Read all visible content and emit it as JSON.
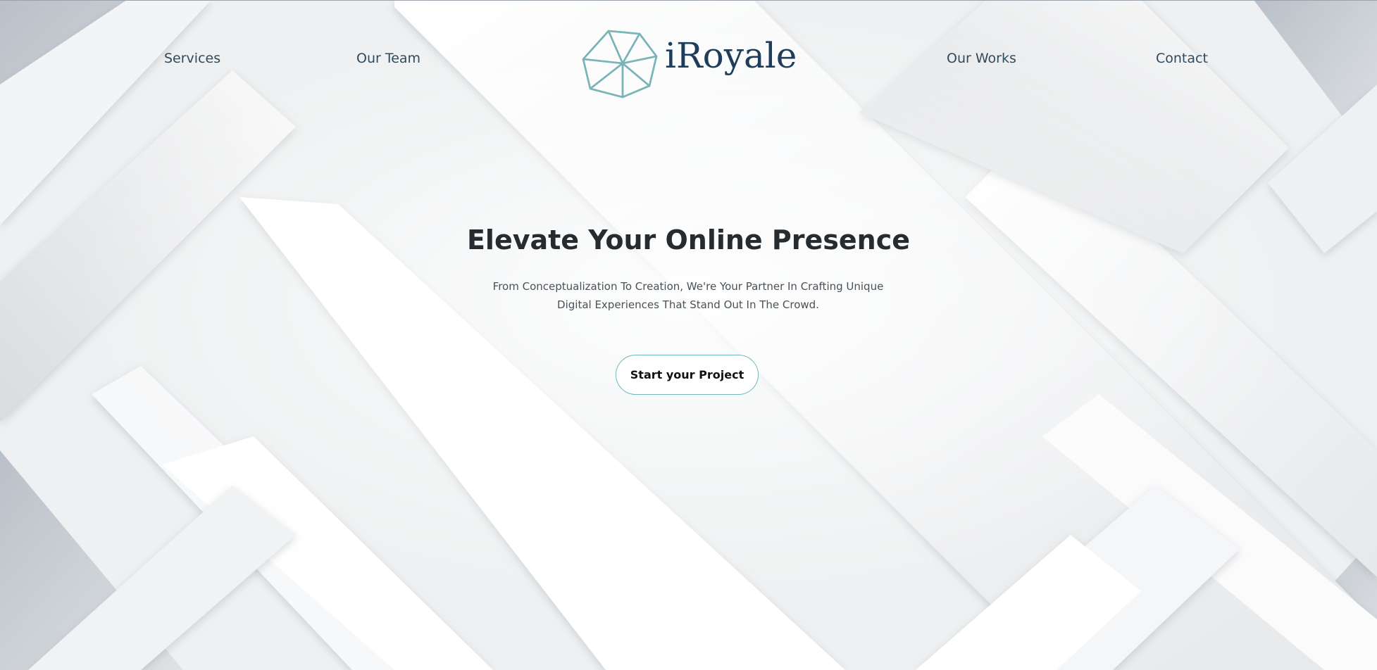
{
  "nav": {
    "left": [
      {
        "label": "Services"
      },
      {
        "label": "Our Team"
      }
    ],
    "right": [
      {
        "label": "Our Works"
      },
      {
        "label": "Contact"
      }
    ]
  },
  "brand": {
    "name": "iRoyale",
    "icon": "polyhedron-logo-icon",
    "icon_color": "#7ab3b8",
    "text_color": "#1f3c5a"
  },
  "hero": {
    "title": "Elevate Your Online Presence",
    "subtitle_line1": "From Conceptualization To Creation, We're Your Partner In Crafting Unique",
    "subtitle_line2": "Digital Experiences That Stand Out In The Crowd.",
    "cta_label": "Start your Project",
    "accent": "#6fb7b9"
  },
  "background": {
    "style": "diagonal white paper strips",
    "base_color": "#f4f5f6",
    "shadow_color": "#a9b1b9"
  }
}
